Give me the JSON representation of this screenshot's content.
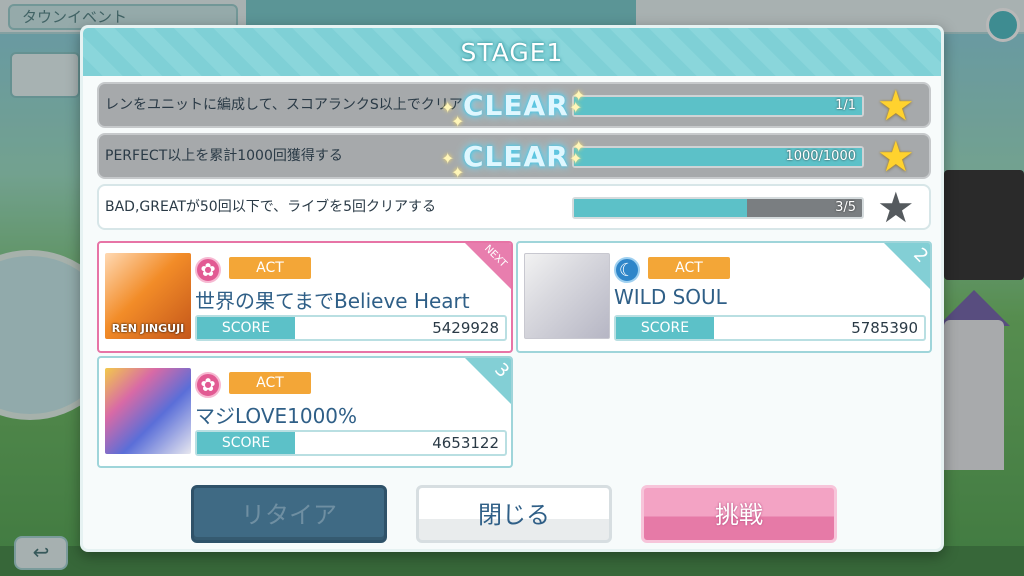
{
  "background": {
    "tab_label": "タウンイベント",
    "back_icon": "back-arrow-icon"
  },
  "dialog": {
    "title": "STAGE1",
    "missions": [
      {
        "text": "レンをユニットに編成して、スコアランクS以上でクリア",
        "status": "CLEAR",
        "progress": "1/1",
        "ratio": 1.0,
        "star": "gold"
      },
      {
        "text": "PERFECT以上を累計1000回獲得する",
        "status": "CLEAR",
        "progress": "1000/1000",
        "ratio": 1.0,
        "star": "gold"
      },
      {
        "text": "BAD,GREATが50回以下で、ライブを5回クリアする",
        "status": "",
        "progress": "3/5",
        "ratio": 0.6,
        "star": "gray"
      }
    ],
    "songs": [
      {
        "title": "世界の果てまでBelieve Heart",
        "type": "ACT",
        "attr_icon": "gear-icon",
        "attr_color": "#e25a93",
        "score_label": "SCORE",
        "score": "5429928",
        "corner": "NEXT",
        "thumb_text": "REN JINGUJI"
      },
      {
        "title": "WILD SOUL",
        "type": "ACT",
        "attr_icon": "moon-icon",
        "attr_color": "#2f86c9",
        "score_label": "SCORE",
        "score": "5785390",
        "corner": "2",
        "thumb_text": ""
      },
      {
        "title": "マジLOVE1000%",
        "type": "ACT",
        "attr_icon": "gear-icon",
        "attr_color": "#e25a93",
        "score_label": "SCORE",
        "score": "4653122",
        "corner": "3",
        "thumb_text": ""
      }
    ],
    "buttons": {
      "retire": "リタイア",
      "close": "閉じる",
      "challenge": "挑戦"
    }
  }
}
